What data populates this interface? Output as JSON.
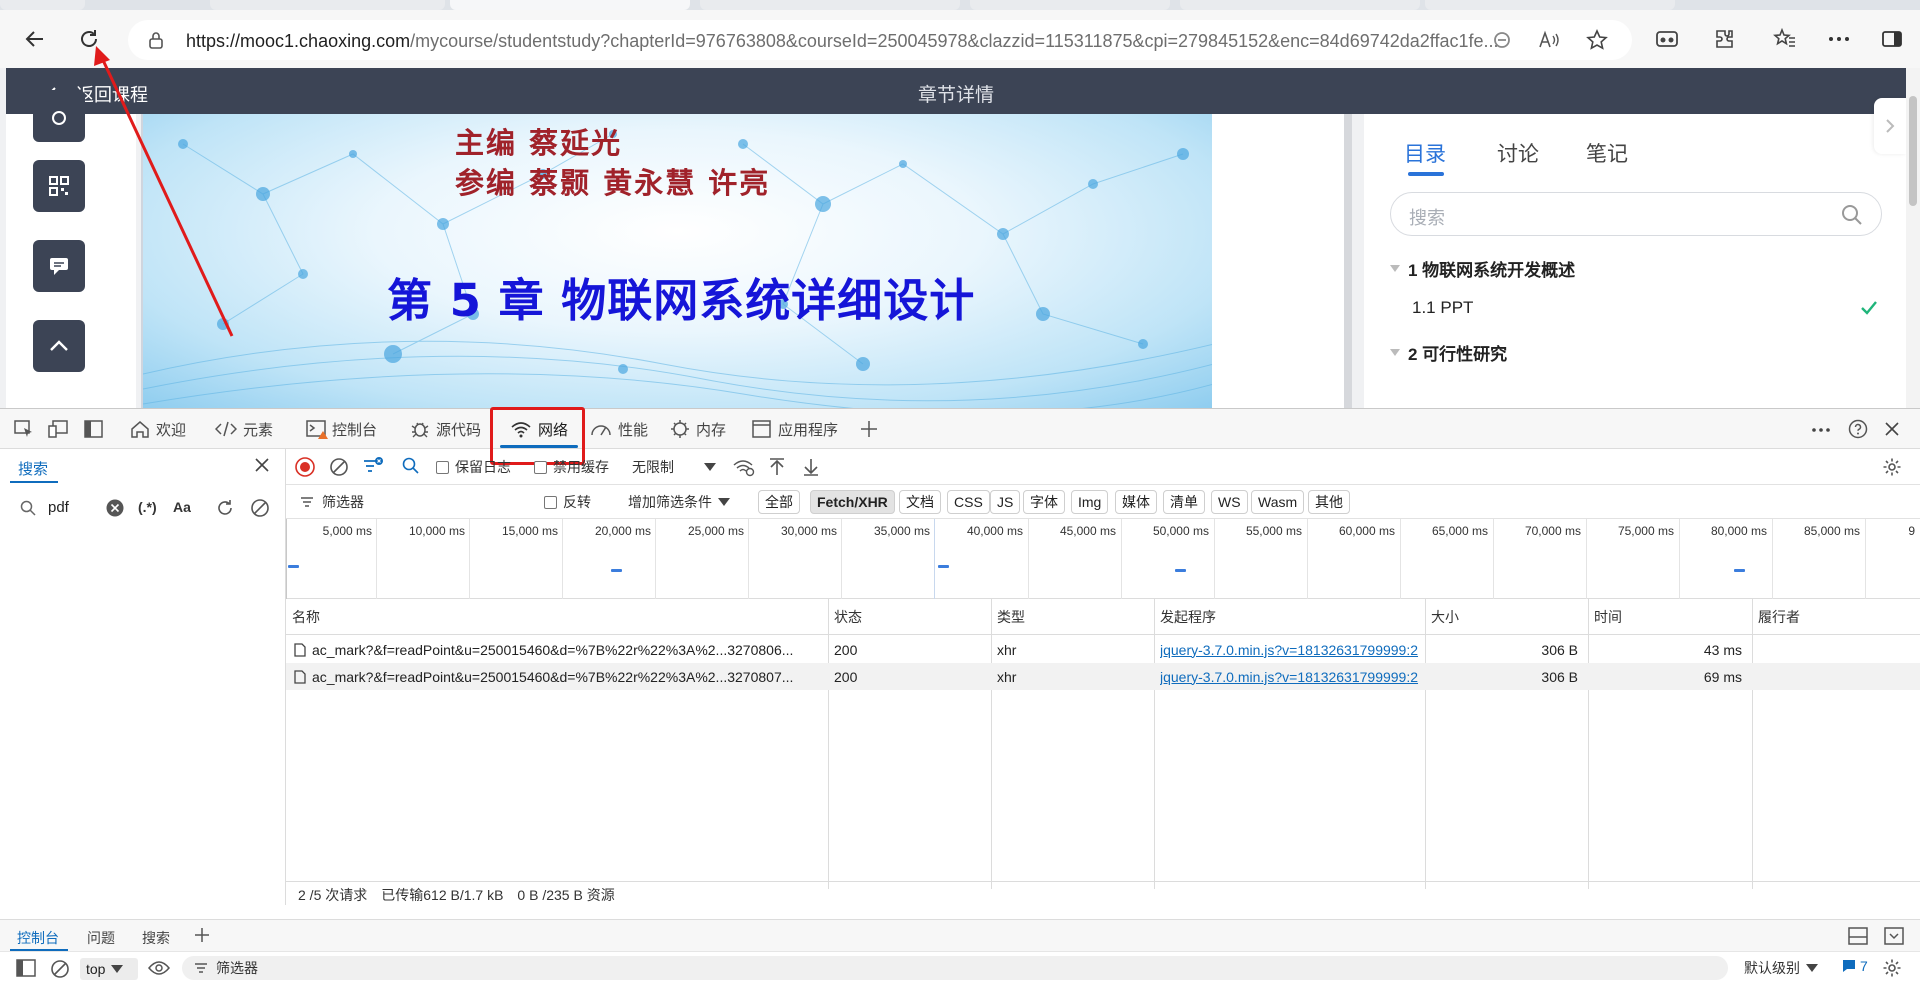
{
  "browser": {
    "url_host": "https://mooc1.chaoxing.com",
    "url_path": "/mycourse/studentstudy?chapterId=976763808&courseId=250045978&clazzid=115311875&cpi=279845152&enc=84d69742da2ffac1fe..."
  },
  "page": {
    "back_label": "返回课程",
    "header_title": "章节详情",
    "slide": {
      "editor_line": "主编 蔡延光",
      "coeditor_line": "参编 蔡颢 黄永慧 许亮",
      "title": "第 5 章  物联网系统详细设计"
    },
    "right_panel": {
      "tabs": [
        "目录",
        "讨论",
        "笔记"
      ],
      "search_placeholder": "搜索",
      "toc": [
        {
          "label": "1 物联网系统开发概述",
          "type": "section"
        },
        {
          "label": "1.1 PPT",
          "type": "item",
          "done": true
        },
        {
          "label": "2 可行性研究",
          "type": "section"
        }
      ]
    }
  },
  "devtools": {
    "tabs": [
      {
        "label": "欢迎",
        "icon": "home-icon"
      },
      {
        "label": "元素",
        "icon": "code-icon"
      },
      {
        "label": "控制台",
        "icon": "console-icon"
      },
      {
        "label": "源代码",
        "icon": "bug-icon"
      },
      {
        "label": "网络",
        "icon": "wifi-icon",
        "active": true
      },
      {
        "label": "性能",
        "icon": "gauge-icon"
      },
      {
        "label": "内存",
        "icon": "chip-icon"
      },
      {
        "label": "应用程序",
        "icon": "app-icon"
      }
    ],
    "search_pane": {
      "tab_label": "搜索",
      "query": "pdf",
      "regex_label": "(.*)",
      "case_label": "Aa"
    },
    "network_toolbar": {
      "preserve_log": "保留日志",
      "disable_cache": "禁用缓存",
      "throttle": "无限制"
    },
    "filter_row": {
      "filter_placeholder": "筛选器",
      "invert": "反转",
      "more_filters": "增加筛选条件",
      "chips": [
        "全部",
        "Fetch/XHR",
        "文档",
        "CSS",
        "JS",
        "字体",
        "Img",
        "媒体",
        "清单",
        "WS",
        "Wasm",
        "其他"
      ],
      "active_chip": "Fetch/XHR"
    },
    "overview": {
      "ticks": [
        "5,000 ms",
        "10,000 ms",
        "15,000 ms",
        "20,000 ms",
        "25,000 ms",
        "30,000 ms",
        "35,000 ms",
        "40,000 ms",
        "45,000 ms",
        "50,000 ms",
        "55,000 ms",
        "60,000 ms",
        "65,000 ms",
        "70,000 ms",
        "75,000 ms",
        "80,000 ms",
        "85,000 ms",
        "9"
      ]
    },
    "table": {
      "headers": [
        "名称",
        "状态",
        "类型",
        "发起程序",
        "大小",
        "时间",
        "履行者"
      ],
      "rows": [
        {
          "name": "ac_mark?&f=readPoint&u=250015460&d=%7B%22r%22%3A%2...3270806...",
          "status": "200",
          "type": "xhr",
          "initiator": "jquery-3.7.0.min.js?v=18132631799999:2",
          "size": "306 B",
          "time": "43 ms",
          "fulfilled_by": ""
        },
        {
          "name": "ac_mark?&f=readPoint&u=250015460&d=%7B%22r%22%3A%2...3270807...",
          "status": "200",
          "type": "xhr",
          "initiator": "jquery-3.7.0.min.js?v=18132631799999:2",
          "size": "306 B",
          "time": "69 ms",
          "fulfilled_by": ""
        }
      ]
    },
    "status_bar": {
      "requests": "2 /5 次请求",
      "transferred": "已传输612 B/1.7 kB",
      "resources": "0 B /235 B 资源"
    },
    "drawer": {
      "tabs": [
        "控制台",
        "问题",
        "搜索"
      ],
      "context": "top",
      "filter_placeholder": "筛选器",
      "level": "默认级别",
      "issues_count": "7"
    }
  },
  "colors": {
    "accent": "#0f6cbd",
    "highlight_box": "#e01b1b",
    "header_bg": "#3c4455",
    "slide_title": "#1515d8",
    "slide_editor": "#a0222a",
    "toc_done": "#1fb57a"
  }
}
